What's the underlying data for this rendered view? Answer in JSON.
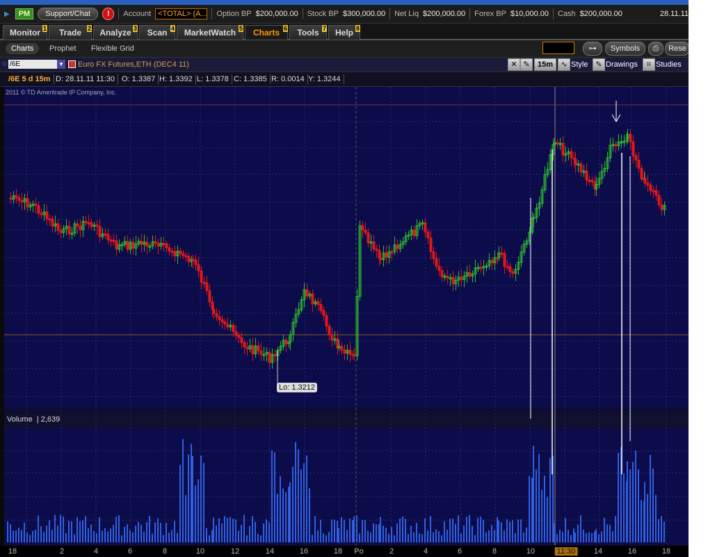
{
  "topbar": {
    "pm_label": "PM",
    "support_label": "Support/Chat",
    "alert_label": "!",
    "account_label": "Account",
    "account_value": "<TOTAL> (A...",
    "option_bp_label": "Option BP",
    "option_bp_value": "$200,000.00",
    "stock_bp_label": "Stock BP",
    "stock_bp_value": "$300,000.00",
    "net_liq_label": "Net Liq",
    "net_liq_value": "$200,000.00",
    "forex_bp_label": "Forex BP",
    "forex_bp_value": "$10,000.00",
    "cash_label": "Cash",
    "cash_value": "$200,000.00",
    "date": "28.11.11"
  },
  "tabs": [
    {
      "label": "Monitor",
      "num": "1"
    },
    {
      "label": "Trade",
      "num": "2"
    },
    {
      "label": "Analyze",
      "num": "3"
    },
    {
      "label": "Scan",
      "num": "4"
    },
    {
      "label": "MarketWatch",
      "num": "5"
    },
    {
      "label": "Charts",
      "num": "6",
      "active": true
    },
    {
      "label": "Tools",
      "num": "7"
    },
    {
      "label": "Help",
      "num": "8"
    }
  ],
  "subtabs": {
    "charts": "Charts",
    "prophet": "Prophet",
    "flexible_grid": "Flexible Grid",
    "symbols": "Symbols",
    "reset": "Rese"
  },
  "chart_toolbar": {
    "symbol": "/6E",
    "description": "Euro FX Futures,ETH (DEC4 11)",
    "interval": "15m",
    "style": "Style",
    "drawings": "Drawings",
    "studies": "Studies"
  },
  "info": {
    "symbol_period": "/6E 5 d 15m",
    "date": "D: 28.11.11 11:30",
    "open": "O: 1.3387",
    "high": "H: 1.3392",
    "low": "L: 1.3378",
    "close": "C: 1.3385",
    "range": "R: 0.0014",
    "y": "Y: 1.3244"
  },
  "copyright": "2011 © TD Ameritrade IP Company, Inc.",
  "lo_label": "Lo: 1.3212",
  "volume": {
    "label": "Volume",
    "value": "2,639"
  },
  "x_labels": [
    {
      "text": "18"
    },
    {
      "text": "2"
    },
    {
      "text": "4"
    },
    {
      "text": "6"
    },
    {
      "text": "8"
    },
    {
      "text": "10"
    },
    {
      "text": "12"
    },
    {
      "text": "14"
    },
    {
      "text": "16"
    },
    {
      "text": "18"
    },
    {
      "text": "Po"
    },
    {
      "text": "2"
    },
    {
      "text": "4"
    },
    {
      "text": "6"
    },
    {
      "text": "8"
    },
    {
      "text": "10"
    },
    {
      "text": "11:30",
      "highlight": true
    },
    {
      "text": "14"
    },
    {
      "text": "16"
    },
    {
      "text": "18"
    }
  ],
  "colors": {
    "background": "#0c0c4a",
    "up_candle": "#2fbf2f",
    "down_candle": "#e01818",
    "volume_bar": "#3060e0",
    "grid": "#2a2a80",
    "accent": "#f90"
  },
  "chart_data": {
    "type": "candlestick",
    "low_marker": 1.3212,
    "last_bar": {
      "date": "28.11.11 11:30",
      "open": 1.3387,
      "high": 1.3392,
      "low": 1.3378,
      "close": 1.3385
    }
  }
}
